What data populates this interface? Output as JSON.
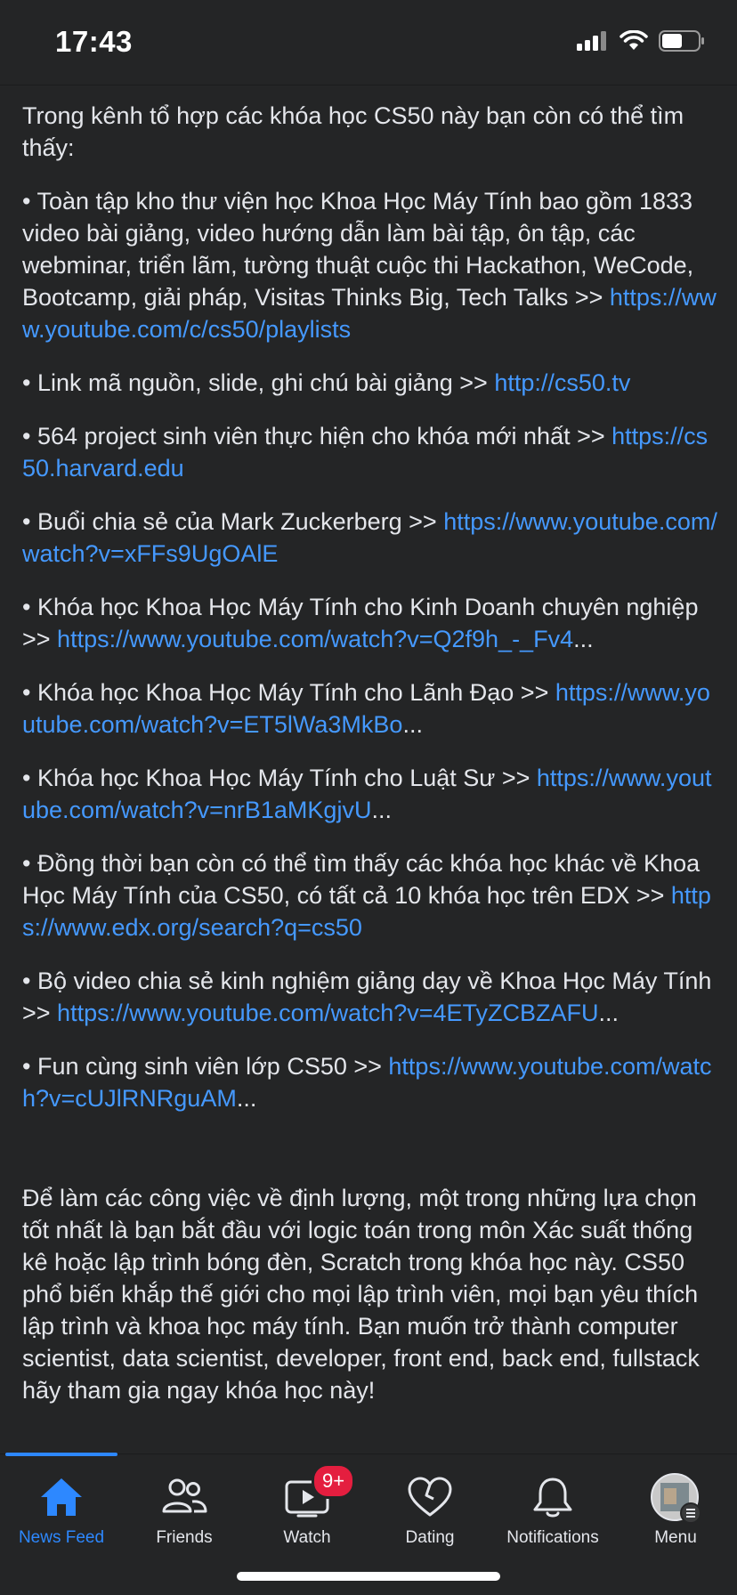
{
  "status": {
    "time": "17:43"
  },
  "post": {
    "intro": "Trong kênh tổ hợp các khóa học CS50 này bạn còn có thể tìm thấy:",
    "items": [
      {
        "text": "• Toàn tập kho thư viện học Khoa Học Máy Tính bao gồm 1833 video bài giảng, video hướng dẫn làm bài tập, ôn tập, các webminar, triển lãm, tường thuật cuộc thi Hackathon, WeCode, Bootcamp, giải pháp, Visitas Thinks Big, Tech Talks >> ",
        "link": "https://www.youtube.com/c/cs50/playlists",
        "suffix": ""
      },
      {
        "text": "• Link mã nguồn, slide, ghi chú bài giảng >> ",
        "link": "http://cs50.tv",
        "suffix": ""
      },
      {
        "text": "• 564 project sinh viên thực hiện cho khóa mới nhất >> ",
        "link": "https://cs50.harvard.edu",
        "suffix": ""
      },
      {
        "text": "• Buổi chia sẻ của Mark Zuckerberg >> ",
        "link": "https://www.youtube.com/watch?v=xFFs9UgOAlE",
        "suffix": ""
      },
      {
        "text": "• Khóa học Khoa Học Máy Tính cho Kinh Doanh chuyên nghiệp >> ",
        "link": "https://www.youtube.com/watch?v=Q2f9h_-_Fv4",
        "suffix": "..."
      },
      {
        "text": "• Khóa học Khoa Học Máy Tính cho Lãnh Đạo >> ",
        "link": "https://www.youtube.com/watch?v=ET5lWa3MkBo",
        "suffix": "..."
      },
      {
        "text": "• Khóa học Khoa Học Máy Tính cho Luật Sư >> ",
        "link": "https://www.youtube.com/watch?v=nrB1aMKgjvU",
        "suffix": "..."
      },
      {
        "text": "• Đồng thời bạn còn có thể tìm thấy các khóa học khác về Khoa Học Máy Tính của CS50, có tất cả 10 khóa học trên EDX >> ",
        "link": "https://www.edx.org/search?q=cs50",
        "suffix": ""
      },
      {
        "text": "• Bộ video chia sẻ kinh nghiệm giảng dạy về Khoa Học Máy Tính >> ",
        "link": "https://www.youtube.com/watch?v=4ETyZCBZAFU",
        "suffix": "..."
      },
      {
        "text": "• Fun cùng sinh viên lớp CS50 >> ",
        "link": "https://www.youtube.com/watch?v=cUJlRNRguAM",
        "suffix": "..."
      }
    ],
    "outro": "Để làm các công việc về định lượng, một trong những lựa chọn tốt nhất là bạn bắt đầu với logic toán trong môn Xác suất thống kê hoặc lập trình bóng đèn, Scratch trong khóa học này. CS50 phổ biến khắp thế giới cho mọi lập trình viên, mọi bạn yêu thích lập trình và khoa học máy tính. Bạn muốn trở thành computer scientist, data scientist, developer, front end, back end, fullstack hãy tham gia ngay khóa học này!"
  },
  "tabs": [
    {
      "label": "News Feed",
      "icon": "home-icon"
    },
    {
      "label": "Friends",
      "icon": "friends-icon"
    },
    {
      "label": "Watch",
      "icon": "watch-icon",
      "badge": "9+"
    },
    {
      "label": "Dating",
      "icon": "heart-icon"
    },
    {
      "label": "Notifications",
      "icon": "bell-icon"
    },
    {
      "label": "Menu",
      "icon": "avatar"
    }
  ],
  "colors": {
    "accent": "#2d88ff",
    "link": "#4599ff",
    "background": "#242526",
    "badge": "#e41e3f"
  }
}
